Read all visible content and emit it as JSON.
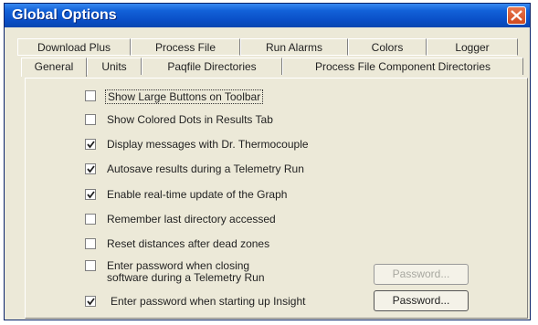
{
  "window": {
    "title": "Global Options"
  },
  "tabs_back": [
    "Download Plus",
    "Process File",
    "Run Alarms",
    "Colors",
    "Logger"
  ],
  "tabs_front": [
    "General",
    "Units",
    "Paqfile Directories",
    "Process File Component Directories"
  ],
  "active_tab": "General",
  "options": [
    {
      "label": "Show Large Buttons on Toolbar",
      "checked": false
    },
    {
      "label": "Show Colored Dots in Results Tab",
      "checked": false
    },
    {
      "label": "Display messages with Dr. Thermocouple",
      "checked": true
    },
    {
      "label": "Autosave results during a Telemetry Run",
      "checked": true
    },
    {
      "label": "Enable real-time update of the Graph",
      "checked": true
    },
    {
      "label": "Remember last directory accessed",
      "checked": false
    },
    {
      "label": "Reset distances after dead zones",
      "checked": false
    },
    {
      "label_line1": "Enter password when closing",
      "label_line2": "software during a Telemetry Run",
      "checked": false,
      "button": "Password...",
      "button_enabled": false
    },
    {
      "label": "Enter password when starting up Insight",
      "checked": true,
      "button": "Password...",
      "button_enabled": true
    }
  ]
}
